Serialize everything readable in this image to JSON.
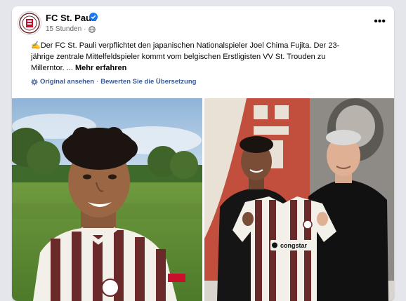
{
  "post": {
    "page_name": "FC St. Pauli",
    "time": "15 Stunden",
    "privacy_icon": "globe-icon",
    "more_label": "•••",
    "text_emoji": "✍️",
    "text_line1": "Der FC St. Pauli verpflichtet den japanischen Nationalspieler Joel Chima Fujita. Der 23-",
    "text_line2": "jährige zentrale Mittelfeldspieler kommt vom belgischen Erstligisten VV St. Trouden zu",
    "text_line3": "Millerntor. ...",
    "more_text": "Mehr erfahren",
    "original_link": "Original ansehen",
    "separator": "·",
    "rate_link": "Bewerten Sie die Übersetzung"
  },
  "photos": {
    "photo1_icon": "player-selfie-image",
    "photo2_icon": "player-signing-image",
    "jersey_sponsor": "congstar"
  },
  "colors": {
    "link": "#385898",
    "verified": "#1877f2",
    "jersey_brown": "#6b2a2a",
    "background": "#e4e6eb"
  }
}
